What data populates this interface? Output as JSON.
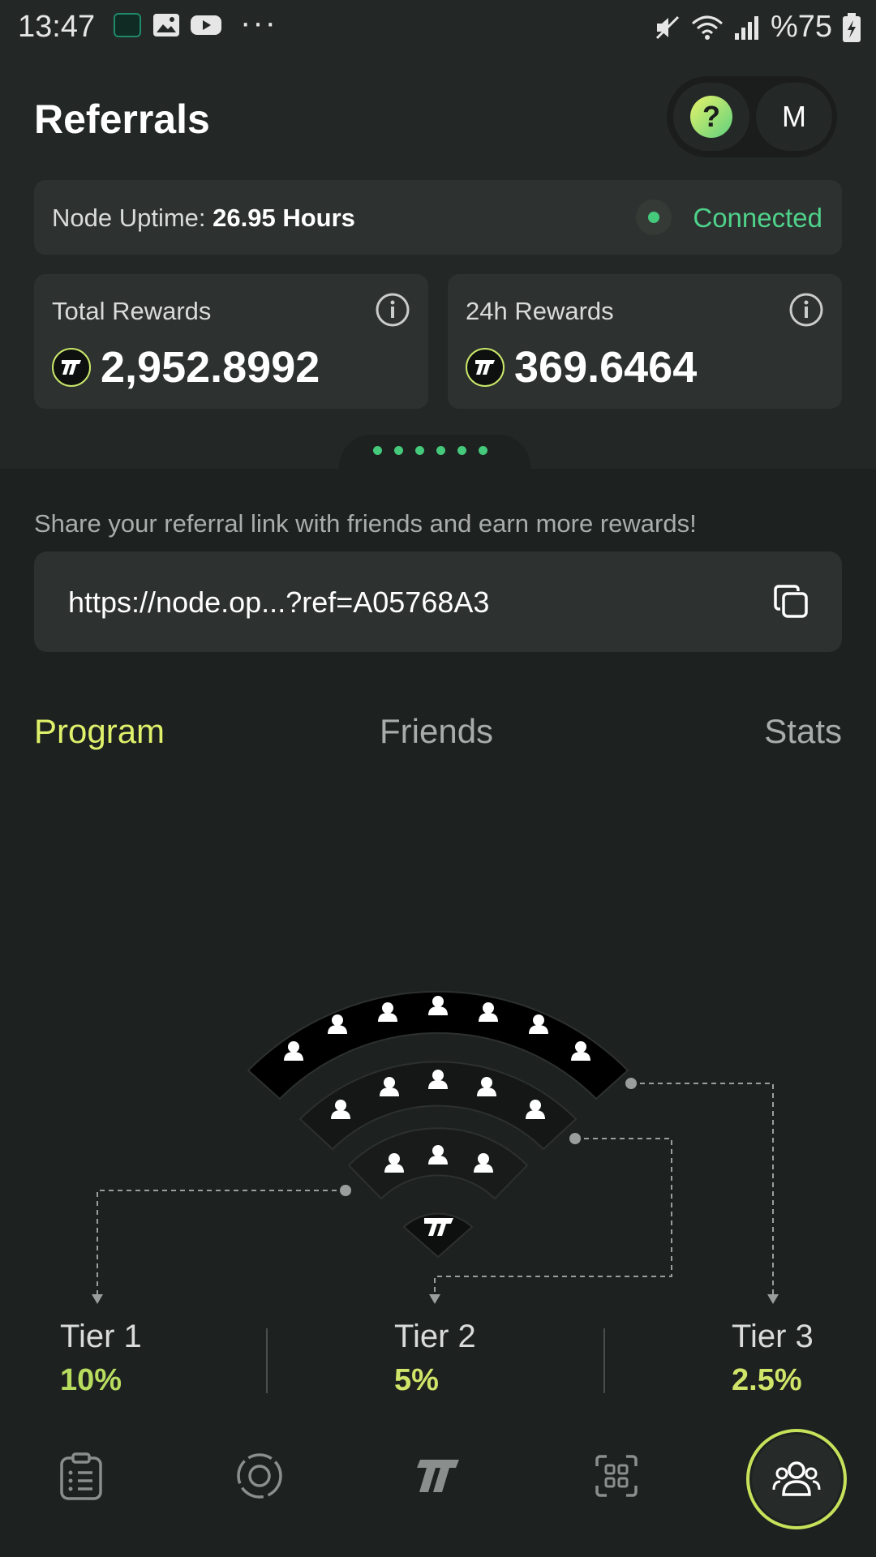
{
  "status_bar": {
    "time": "13:47",
    "more": "···",
    "battery": "%75"
  },
  "header": {
    "title": "Referrals",
    "help_label": "?",
    "avatar_initial": "M"
  },
  "uptime": {
    "label": "Node Uptime:",
    "value": "26.95 Hours",
    "status": "Connected"
  },
  "rewards": [
    {
      "label": "Total Rewards",
      "value": "2,952.8992"
    },
    {
      "label": "24h Rewards",
      "value": "369.6464"
    }
  ],
  "share": {
    "text": "Share your referral link with friends and earn more rewards!",
    "link": "https://node.op...?ref=A05768A3"
  },
  "tabs": [
    {
      "label": "Program",
      "active": true
    },
    {
      "label": "Friends",
      "active": false
    },
    {
      "label": "Stats",
      "active": false
    }
  ],
  "tiers": [
    {
      "name": "Tier 1",
      "percent": "10%",
      "color": "#b8dd5e"
    },
    {
      "name": "Tier 2",
      "percent": "5%",
      "color": "#cfe468"
    },
    {
      "name": "Tier 3",
      "percent": "2.5%",
      "color": "#cfe468"
    }
  ],
  "bottom_nav": [
    {
      "icon": "clipboard-list-icon",
      "active": false
    },
    {
      "icon": "target-icon",
      "active": false
    },
    {
      "icon": "logo-icon",
      "active": false
    },
    {
      "icon": "apps-grid-icon",
      "active": false
    },
    {
      "icon": "users-icon",
      "active": true
    }
  ],
  "colors": {
    "accent_green": "#45c97a",
    "accent_lime": "#dff06a",
    "background": "#1c201f",
    "card": "#2d312f"
  }
}
